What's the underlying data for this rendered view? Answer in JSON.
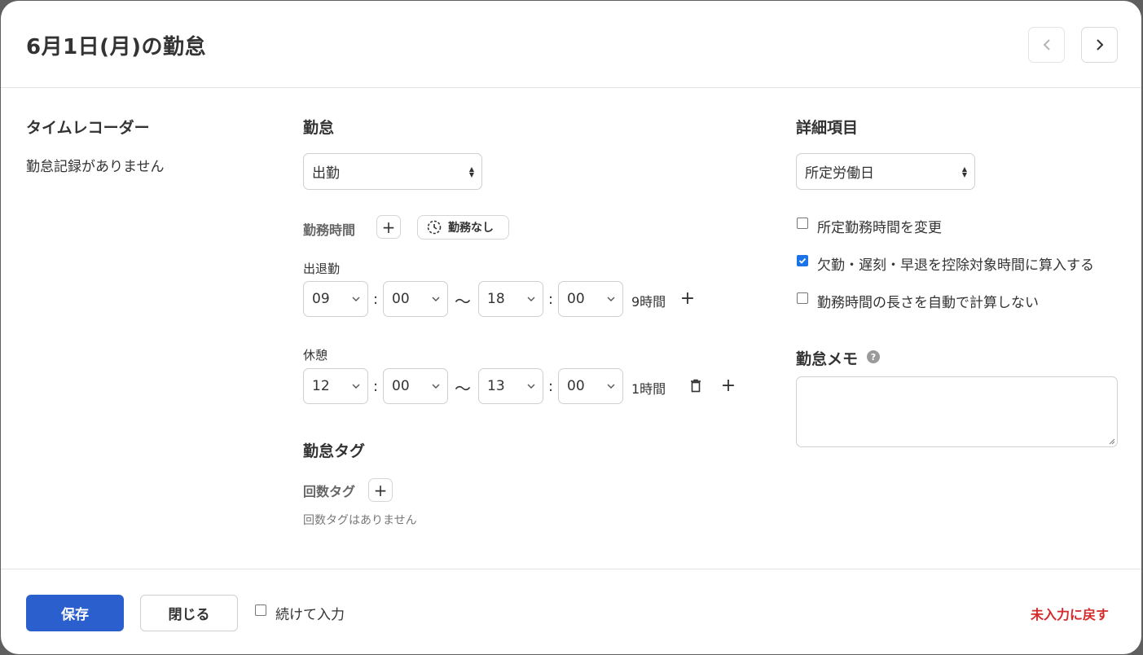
{
  "header": {
    "title": "6月1日(月)の勤怠",
    "prev_icon": "chevron-left-icon",
    "next_icon": "chevron-right-icon"
  },
  "timerecorder": {
    "title": "タイムレコーダー",
    "empty_text": "勤怠記録がありません"
  },
  "attendance": {
    "title": "勤怠",
    "type_select": {
      "value": "出勤"
    },
    "work_time": {
      "label": "勤務時間",
      "add_icon": "plus-icon",
      "no_work_label": "勤務なし",
      "no_work_icon": "clock-icon"
    },
    "clock_in_out": {
      "label": "出退勤",
      "start_hour": "09",
      "start_minute": "00",
      "separator": ":",
      "tilde": "～",
      "end_hour": "18",
      "end_minute": "00",
      "duration": "9時間"
    },
    "break": {
      "label": "休憩",
      "start_hour": "12",
      "start_minute": "00",
      "end_hour": "13",
      "end_minute": "00",
      "duration": "1時間",
      "delete_icon": "trash-icon"
    },
    "tags": {
      "title": "勤怠タグ",
      "count_tag_label": "回数タグ",
      "count_tag_empty": "回数タグはありません"
    }
  },
  "details": {
    "title": "詳細項目",
    "day_type_select": {
      "value": "所定労働日"
    },
    "options": [
      {
        "label": "所定勤務時間を変更",
        "checked": false
      },
      {
        "label": "欠勤・遅刻・早退を控除対象時間に算入する",
        "checked": true
      },
      {
        "label": "勤務時間の長さを自動で計算しない",
        "checked": false
      }
    ],
    "memo": {
      "title": "勤怠メモ",
      "help_icon": "question-circle-icon",
      "value": ""
    }
  },
  "footer": {
    "save_label": "保存",
    "close_label": "閉じる",
    "continue_label": "続けて入力",
    "continue_checked": false,
    "reset_label": "未入力に戻す"
  },
  "colors": {
    "primary": "#2a5fcd",
    "danger": "#d42a2a",
    "checkbox": "#1a73e8"
  }
}
